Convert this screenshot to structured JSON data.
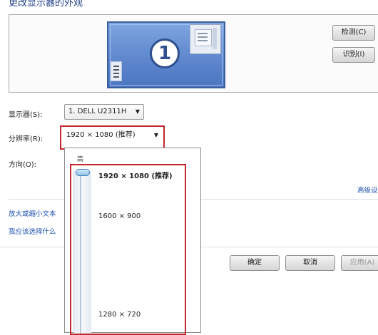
{
  "window": {
    "title": "更改显示器的外观"
  },
  "preview": {
    "monitor_number": "1"
  },
  "buttons": {
    "detect": "检测(C)",
    "identify": "识别(I)",
    "ok": "确定",
    "cancel": "取消",
    "apply": "应用(A)"
  },
  "settings": {
    "display_label": "显示器(S):",
    "display_value": "1. DELL U2311H",
    "resolution_label": "分辨率(R):",
    "resolution_value": "1920 × 1080 (推荐)",
    "orientation_label": "方向(O):"
  },
  "links": {
    "advanced": "高级设",
    "enlarge_text": "放大或缩小文本",
    "which_to_choose": "我应该选择什么"
  },
  "resolution_dropdown": {
    "high_label": "高",
    "options": [
      "1920 × 1080 (推荐)",
      "1600 × 900",
      "1280 × 720"
    ],
    "selected_index": 0
  },
  "colors": {
    "highlight_red": "#c1272d",
    "link_blue": "#1f52b0",
    "title_blue": "#1e3d8a"
  },
  "icons": [
    "monitor-1-icon",
    "monitor-2-icon",
    "dropdown-arrow-icon",
    "slider-thumb-icon"
  ]
}
